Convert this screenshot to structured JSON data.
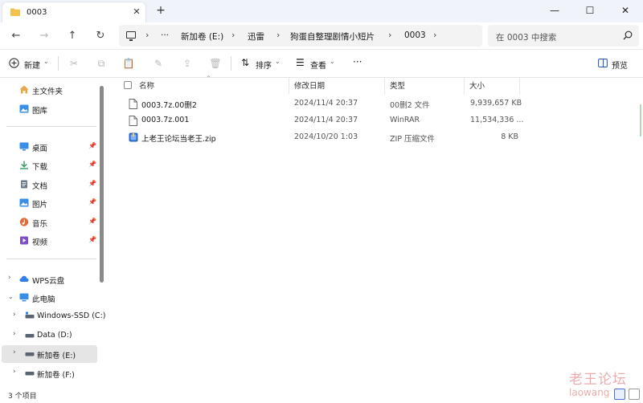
{
  "window": {
    "tab_title": "0003",
    "new_tab": "+",
    "close_tab": "✕",
    "minimize": "—",
    "maximize": "☐",
    "close": "✕"
  },
  "nav": {
    "back": "←",
    "forward": "→",
    "up": "↑",
    "refresh": "↻"
  },
  "address": {
    "more": "···",
    "breadcrumbs": [
      "新加卷 (E:)",
      "迅雷",
      "狗蛋自整理剧情小短片",
      "0003"
    ],
    "separator": "›"
  },
  "search": {
    "placeholder": "在 0003 中搜索"
  },
  "toolbar": {
    "new_label": "新建",
    "sort_label": "排序",
    "view_label": "查看",
    "more_label": "···",
    "preview_label": "预览"
  },
  "sidebar": {
    "quick": [
      {
        "label": "主文件夹",
        "icon": "home-icon"
      },
      {
        "label": "图库",
        "icon": "gallery-icon"
      }
    ],
    "pinned": [
      {
        "label": "桌面",
        "icon": "desktop-icon",
        "color": "#3a8ee6"
      },
      {
        "label": "下载",
        "icon": "download-icon",
        "color": "#2e9a5e"
      },
      {
        "label": "文档",
        "icon": "document-icon",
        "color": "#6b7b8c"
      },
      {
        "label": "图片",
        "icon": "pictures-icon",
        "color": "#3a8ee6"
      },
      {
        "label": "音乐",
        "icon": "music-icon",
        "color": "#e06b3a"
      },
      {
        "label": "视频",
        "icon": "video-icon",
        "color": "#7b4fc9"
      }
    ],
    "pin_glyph": "📌",
    "tree": [
      {
        "label": "WPS云盘",
        "icon": "cloud-icon",
        "expanded": false
      },
      {
        "label": "此电脑",
        "icon": "computer-icon",
        "expanded": true
      },
      {
        "label": "Windows-SSD (C:)",
        "icon": "drive-icon",
        "expanded": false
      },
      {
        "label": "Data (D:)",
        "icon": "drive-icon",
        "expanded": false
      },
      {
        "label": "新加卷 (E:)",
        "icon": "drive-icon",
        "expanded": false,
        "selected": true
      },
      {
        "label": "新加卷 (F:)",
        "icon": "drive-icon",
        "expanded": false
      }
    ]
  },
  "columns": {
    "name": "名称",
    "modified": "修改日期",
    "type": "类型",
    "size": "大小"
  },
  "files": [
    {
      "name": "0003.7z.00删2",
      "modified": "2024/11/4 20:37",
      "type": "00删2 文件",
      "size": "9,939,657 KB",
      "icon": "file-icon"
    },
    {
      "name": "0003.7z.001",
      "modified": "2024/11/4 20:37",
      "type": "WinRAR",
      "size": "11,534,336 ...",
      "icon": "file-icon"
    },
    {
      "name": "上老王论坛当老王.zip",
      "modified": "2024/10/20 1:03",
      "type": "ZIP 压缩文件",
      "size": "8 KB",
      "icon": "zip-icon"
    }
  ],
  "status": {
    "item_count": "3 个项目"
  },
  "watermark": {
    "line1": "老王论坛",
    "line2": "laowang"
  },
  "colors": {
    "accent": "#4a6fd8",
    "folder": "#f2c14e",
    "watermark": "#e8a5a5"
  }
}
